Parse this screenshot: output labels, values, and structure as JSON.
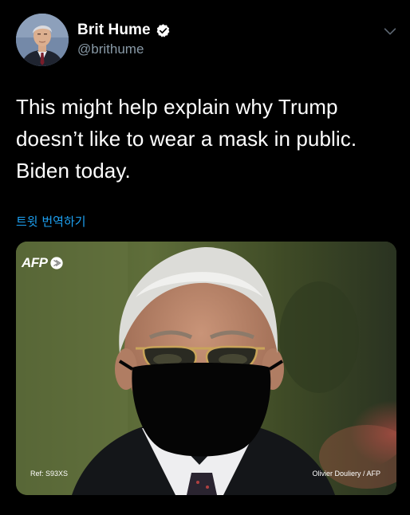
{
  "tweet": {
    "author": {
      "name": "Brit Hume",
      "handle": "@brithume",
      "verified": true
    },
    "text": "This might help explain why Trump\ndoesn’t like to wear a mask in public.\nBiden today.",
    "translate_link": "트윗 번역하기",
    "media": {
      "watermark": "AFP",
      "ref": "Ref: S93XS",
      "credit": "Olivier Douliery / AFP"
    }
  },
  "colors": {
    "background": "#000000",
    "text": "#ffffff",
    "secondary_text": "#8899a6",
    "link": "#1da1f2",
    "verified_badge": "#ffffff"
  },
  "icons": {
    "verified": "verified-badge-icon",
    "menu": "chevron-down-icon"
  }
}
